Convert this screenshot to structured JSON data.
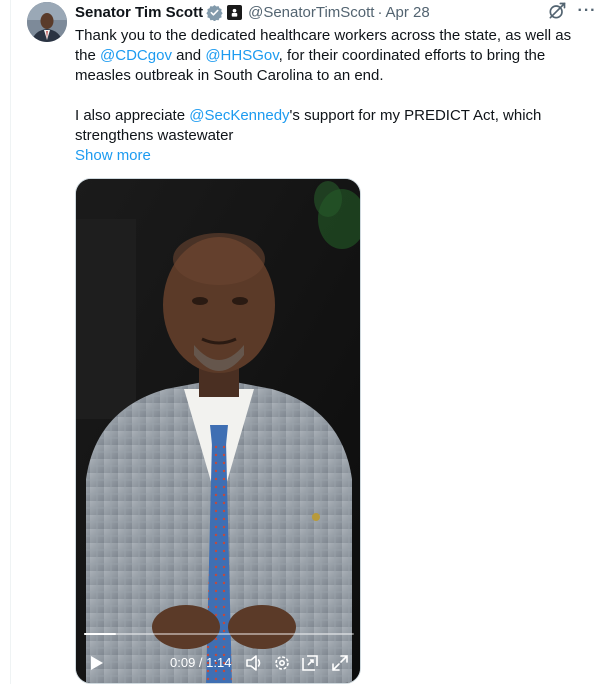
{
  "author": {
    "name": "Senator Tim Scott",
    "handle": "@SenatorTimScott",
    "separator": "·",
    "date": "Apr 28",
    "avatar_icon": "profile-photo",
    "verified_icon": "verified-badge-gray",
    "affiliation_icon": "government-badge"
  },
  "menu": {
    "more_label": "···",
    "grok_icon": "grok-icon"
  },
  "tweet": {
    "p1": {
      "t1": "Thank you to the dedicated healthcare workers across the state, as well as the ",
      "m1": "@CDCgov",
      "t2": " and ",
      "m2": "@HHSGov",
      "t3": ", for their coordinated efforts to bring the measles outbreak in South Carolina to an end."
    },
    "p2": {
      "t1": "I also appreciate ",
      "m1": "@SecKennedy",
      "t2": "'s support for my PREDICT Act, which strengthens wastewater"
    },
    "show_more": "Show more"
  },
  "video": {
    "time": "0:09 / 1:14",
    "progress": 0.12,
    "controls": [
      "play-icon",
      "volume-icon",
      "settings-icon",
      "pip-icon",
      "fullscreen-icon"
    ]
  },
  "colors": {
    "link": "#1d9bf0",
    "text": "#0f1419",
    "muted": "#536471"
  }
}
